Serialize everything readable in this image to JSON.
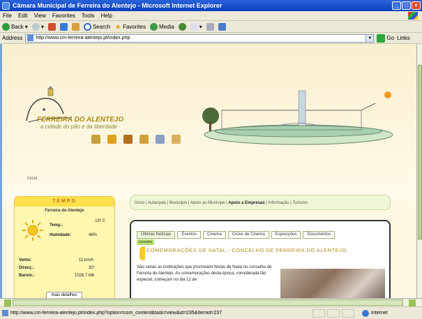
{
  "window": {
    "title": "Câmara Municipal de Ferreira do Alentejo - Microsoft Internet Explorer",
    "buttons": [
      "_",
      "□",
      "×"
    ]
  },
  "menu": [
    "File",
    "Edit",
    "View",
    "Favorites",
    "Tools",
    "Help"
  ],
  "toolbar": {
    "back": "Back",
    "search": "Search",
    "favorites": "Favorites",
    "media": "Media"
  },
  "address": {
    "label": "Address",
    "value": "http://www.cm-ferreira-alentejo.pt/index.php",
    "go": "Go",
    "links": "Links"
  },
  "page": {
    "logo_name": "FERREIRA DO ALENTEJO",
    "logo_tag": "a cidade do pão e da liberdade",
    "breadcrumb": "Início",
    "weather": {
      "title": "TEMPO",
      "place": "Ferreira do Alentejo",
      "temp_label": "Temp.:",
      "temp_value": "15º C",
      "humidity_label": "Humidade:",
      "humidity_value": "48%",
      "wind_label": "Vento:",
      "wind_value": "11 km/h",
      "direction_label": "Direcç.:",
      "direction_value": "30°",
      "pressure_label": "Barom.:",
      "pressure_value": "1026.7 Mb",
      "button": "mais detalhes"
    },
    "topnav": {
      "items": [
        "Início",
        "Autarquia",
        "Município",
        "Apoio ao Munícipe",
        "Apoio a Empresas",
        "Informação",
        "Turismo"
      ],
      "active_index": 4
    },
    "tabs": [
      "Últimas Notícias",
      "Eventos",
      "Cinema",
      "Ciclos de Cinema",
      "Exposições",
      "Documentos"
    ],
    "subtab": "recentes",
    "news": {
      "title": "COMEMORAÇÕES DE NATAL - CONCELHO DE FERREIRA DO ALENTEJO",
      "body": "São várias as instituições que promovem festas de Natal no concelho de Ferreira do Alentejo. As comemorações desta época, considerada tão especial, começam no dia 12 de"
    }
  },
  "status": {
    "url": "http://www.cm-ferreira-alentejo.pt/index.php?option=com_content&task=view&id=235&Itemid=237",
    "zone": "Internet"
  },
  "colors": {
    "title_bar": "#0b3fbf",
    "page_bg": "#fff8e2",
    "accent_gold": "#b08a18",
    "weather_header": "#ffe04a"
  }
}
